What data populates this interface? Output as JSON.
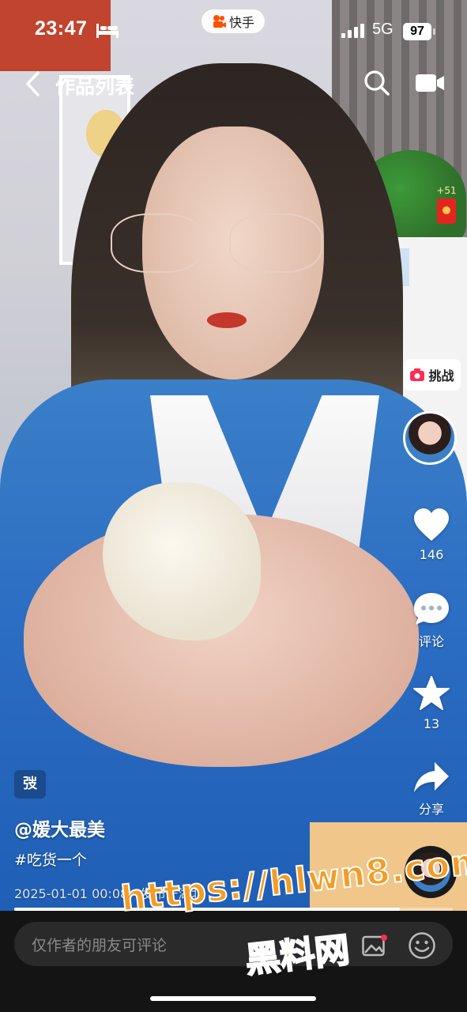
{
  "status_bar": {
    "time": "23:47",
    "app_pill": "快手",
    "network": "5G",
    "battery": "97"
  },
  "nav": {
    "title": "作品列表"
  },
  "red_packet": {
    "count": "+51"
  },
  "actions": {
    "challenge_label": "挑战",
    "likes": "146",
    "comment_label": "评论",
    "favorites": "13",
    "share_label": "分享"
  },
  "post": {
    "tag": "弢",
    "author": "@媛大最美",
    "hashtag": "#吃货一个",
    "meta": "2025-01-01 00:08 · 发布于湖北"
  },
  "progress": {
    "fraction": 0.88
  },
  "comment_input": {
    "placeholder": "仅作者的朋友可评论"
  },
  "watermark": {
    "line1": "https://hlwn8.com",
    "line2": "黑料网"
  },
  "colors": {
    "accent": "#f49c24",
    "red": "#e4251f"
  }
}
